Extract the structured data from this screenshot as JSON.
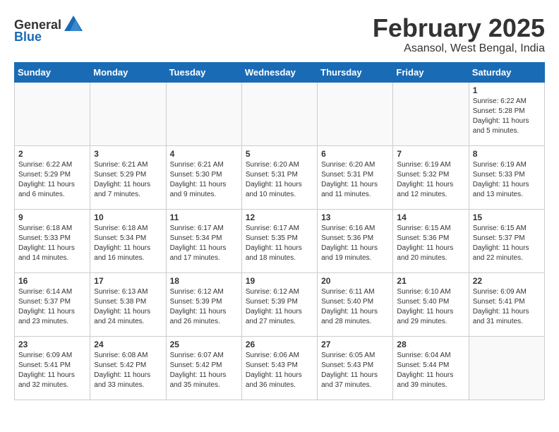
{
  "header": {
    "logo_general": "General",
    "logo_blue": "Blue",
    "month_title": "February 2025",
    "location": "Asansol, West Bengal, India"
  },
  "days_of_week": [
    "Sunday",
    "Monday",
    "Tuesday",
    "Wednesday",
    "Thursday",
    "Friday",
    "Saturday"
  ],
  "weeks": [
    [
      {
        "day": "",
        "info": ""
      },
      {
        "day": "",
        "info": ""
      },
      {
        "day": "",
        "info": ""
      },
      {
        "day": "",
        "info": ""
      },
      {
        "day": "",
        "info": ""
      },
      {
        "day": "",
        "info": ""
      },
      {
        "day": "1",
        "info": "Sunrise: 6:22 AM\nSunset: 5:28 PM\nDaylight: 11 hours and 5 minutes."
      }
    ],
    [
      {
        "day": "2",
        "info": "Sunrise: 6:22 AM\nSunset: 5:29 PM\nDaylight: 11 hours and 6 minutes."
      },
      {
        "day": "3",
        "info": "Sunrise: 6:21 AM\nSunset: 5:29 PM\nDaylight: 11 hours and 7 minutes."
      },
      {
        "day": "4",
        "info": "Sunrise: 6:21 AM\nSunset: 5:30 PM\nDaylight: 11 hours and 9 minutes."
      },
      {
        "day": "5",
        "info": "Sunrise: 6:20 AM\nSunset: 5:31 PM\nDaylight: 11 hours and 10 minutes."
      },
      {
        "day": "6",
        "info": "Sunrise: 6:20 AM\nSunset: 5:31 PM\nDaylight: 11 hours and 11 minutes."
      },
      {
        "day": "7",
        "info": "Sunrise: 6:19 AM\nSunset: 5:32 PM\nDaylight: 11 hours and 12 minutes."
      },
      {
        "day": "8",
        "info": "Sunrise: 6:19 AM\nSunset: 5:33 PM\nDaylight: 11 hours and 13 minutes."
      }
    ],
    [
      {
        "day": "9",
        "info": "Sunrise: 6:18 AM\nSunset: 5:33 PM\nDaylight: 11 hours and 14 minutes."
      },
      {
        "day": "10",
        "info": "Sunrise: 6:18 AM\nSunset: 5:34 PM\nDaylight: 11 hours and 16 minutes."
      },
      {
        "day": "11",
        "info": "Sunrise: 6:17 AM\nSunset: 5:34 PM\nDaylight: 11 hours and 17 minutes."
      },
      {
        "day": "12",
        "info": "Sunrise: 6:17 AM\nSunset: 5:35 PM\nDaylight: 11 hours and 18 minutes."
      },
      {
        "day": "13",
        "info": "Sunrise: 6:16 AM\nSunset: 5:36 PM\nDaylight: 11 hours and 19 minutes."
      },
      {
        "day": "14",
        "info": "Sunrise: 6:15 AM\nSunset: 5:36 PM\nDaylight: 11 hours and 20 minutes."
      },
      {
        "day": "15",
        "info": "Sunrise: 6:15 AM\nSunset: 5:37 PM\nDaylight: 11 hours and 22 minutes."
      }
    ],
    [
      {
        "day": "16",
        "info": "Sunrise: 6:14 AM\nSunset: 5:37 PM\nDaylight: 11 hours and 23 minutes."
      },
      {
        "day": "17",
        "info": "Sunrise: 6:13 AM\nSunset: 5:38 PM\nDaylight: 11 hours and 24 minutes."
      },
      {
        "day": "18",
        "info": "Sunrise: 6:12 AM\nSunset: 5:39 PM\nDaylight: 11 hours and 26 minutes."
      },
      {
        "day": "19",
        "info": "Sunrise: 6:12 AM\nSunset: 5:39 PM\nDaylight: 11 hours and 27 minutes."
      },
      {
        "day": "20",
        "info": "Sunrise: 6:11 AM\nSunset: 5:40 PM\nDaylight: 11 hours and 28 minutes."
      },
      {
        "day": "21",
        "info": "Sunrise: 6:10 AM\nSunset: 5:40 PM\nDaylight: 11 hours and 29 minutes."
      },
      {
        "day": "22",
        "info": "Sunrise: 6:09 AM\nSunset: 5:41 PM\nDaylight: 11 hours and 31 minutes."
      }
    ],
    [
      {
        "day": "23",
        "info": "Sunrise: 6:09 AM\nSunset: 5:41 PM\nDaylight: 11 hours and 32 minutes."
      },
      {
        "day": "24",
        "info": "Sunrise: 6:08 AM\nSunset: 5:42 PM\nDaylight: 11 hours and 33 minutes."
      },
      {
        "day": "25",
        "info": "Sunrise: 6:07 AM\nSunset: 5:42 PM\nDaylight: 11 hours and 35 minutes."
      },
      {
        "day": "26",
        "info": "Sunrise: 6:06 AM\nSunset: 5:43 PM\nDaylight: 11 hours and 36 minutes."
      },
      {
        "day": "27",
        "info": "Sunrise: 6:05 AM\nSunset: 5:43 PM\nDaylight: 11 hours and 37 minutes."
      },
      {
        "day": "28",
        "info": "Sunrise: 6:04 AM\nSunset: 5:44 PM\nDaylight: 11 hours and 39 minutes."
      },
      {
        "day": "",
        "info": ""
      }
    ]
  ]
}
